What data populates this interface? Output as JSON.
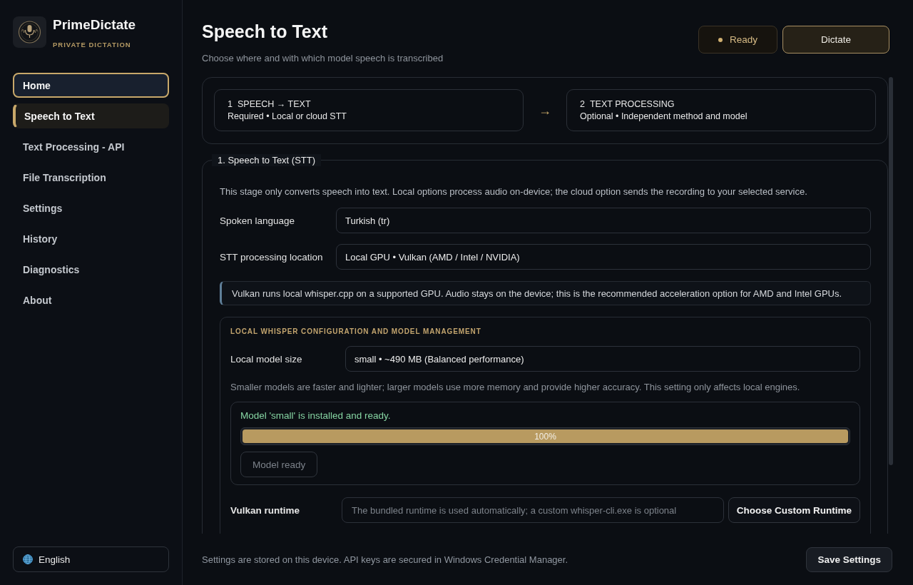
{
  "sidebar": {
    "app_name": "PrimeDictate",
    "tagline": "PRIVATE DICTATION",
    "nav": [
      {
        "label": "Home",
        "selected": false,
        "focused": true
      },
      {
        "label": "Speech to Text",
        "selected": true,
        "focused": false
      },
      {
        "label": "Text Processing - API",
        "selected": false,
        "focused": false
      },
      {
        "label": "File Transcription",
        "selected": false,
        "focused": false
      },
      {
        "label": "Settings",
        "selected": false,
        "focused": false
      },
      {
        "label": "History",
        "selected": false,
        "focused": false
      },
      {
        "label": "Diagnostics",
        "selected": false,
        "focused": false
      },
      {
        "label": "About",
        "selected": false,
        "focused": false
      }
    ],
    "language": "English"
  },
  "header": {
    "title": "Speech to Text",
    "subtitle": "Choose where and with which model speech is transcribed",
    "status": "Ready",
    "dictate_button": "Dictate"
  },
  "pipeline": {
    "steps": [
      {
        "number": "1",
        "title": "SPEECH → TEXT",
        "detail": "Required • Local or cloud STT"
      },
      {
        "number": "2",
        "title": "TEXT PROCESSING",
        "detail": "Optional • Independent method and model"
      }
    ],
    "arrow": "→"
  },
  "stt_section": {
    "legend": "1. Speech to Text (STT)",
    "description": "This stage only converts speech into text. Local options process audio on-device; the cloud option sends the recording to your selected service.",
    "fields": [
      {
        "label": "Spoken language",
        "value": "Turkish (tr)"
      },
      {
        "label": "STT processing location",
        "value": "Local GPU • Vulkan (AMD / Intel / NVIDIA)"
      }
    ],
    "note": "Vulkan runs local whisper.cpp on a supported GPU. Audio stays on the device; this is the recommended acceleration option for AMD and Intel GPUs.",
    "local_panel": {
      "heading": "LOCAL WHISPER CONFIGURATION AND MODEL MANAGEMENT",
      "model_size": {
        "label": "Local model size",
        "value": "small • ~490 MB (Balanced performance)"
      },
      "hint": "Smaller models are faster and lighter; larger models use more memory and provide higher accuracy. This setting only affects local engines.",
      "model_status": {
        "message": "Model 'small' is installed and ready.",
        "progress": {
          "level": 1,
          "reading": "100%"
        },
        "button": {
          "label": "Model ready",
          "disabled": true
        }
      },
      "runtime": {
        "label": "Vulkan runtime",
        "placeholder": "The bundled runtime is used automatically; a custom whisper-cli.exe is optional",
        "button": "Choose Custom Runtime"
      }
    }
  },
  "footer": {
    "note": "Settings are stored on this device. API keys are secured in Windows Credential Manager.",
    "save_button": "Save Settings"
  }
}
